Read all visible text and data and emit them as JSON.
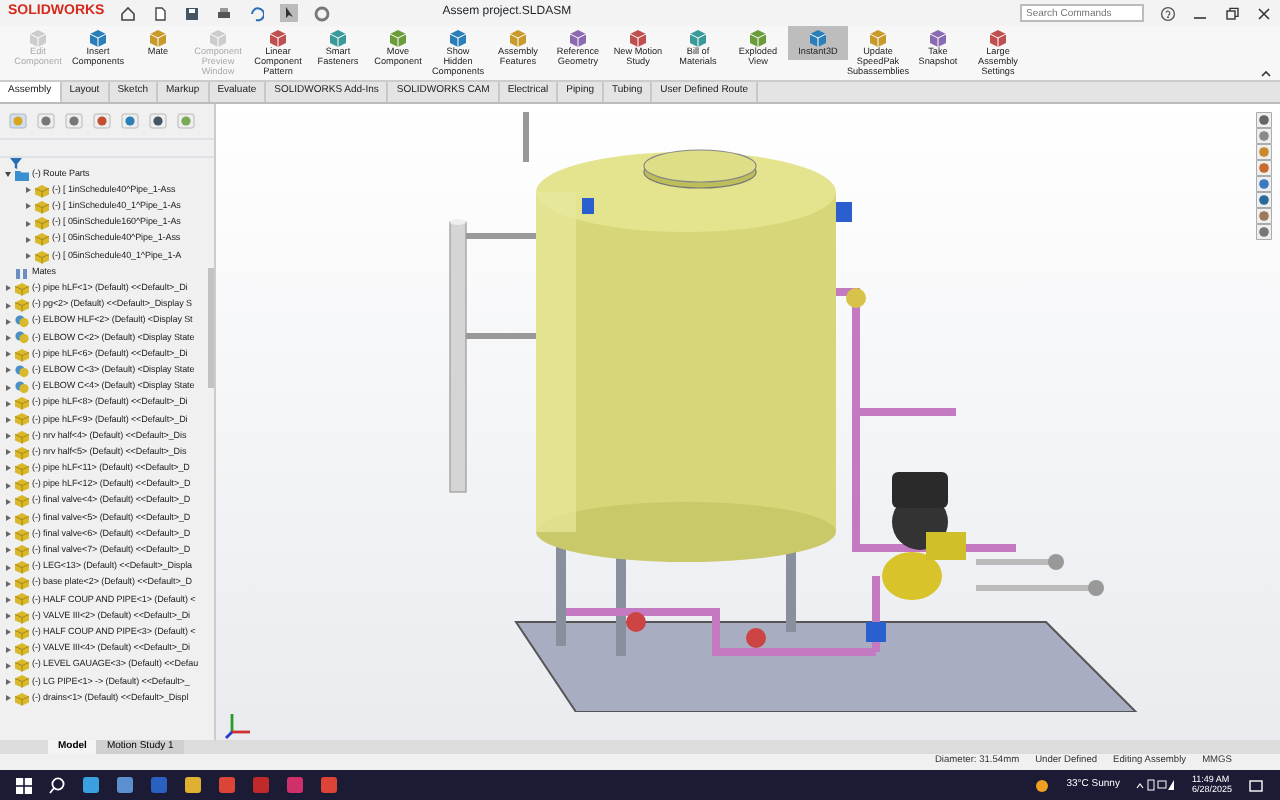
{
  "window": {
    "logo": "SOLIDWORKS",
    "title": "Assem project.SLDASM",
    "search": {
      "placeholder": "Search Commands"
    }
  },
  "ribbon": [
    {
      "label": "Edit Component",
      "disabled": true,
      "selected": false
    },
    {
      "label": "Insert Components",
      "disabled": false,
      "selected": false
    },
    {
      "label": "Mate",
      "disabled": false,
      "selected": false
    },
    {
      "label": "Component Preview Window",
      "disabled": true,
      "selected": false
    },
    {
      "label": "Linear Component Pattern",
      "disabled": false,
      "selected": false
    },
    {
      "label": "Smart Fasteners",
      "disabled": false,
      "selected": false
    },
    {
      "label": "Move Component",
      "disabled": false,
      "selected": false
    },
    {
      "label": "Show Hidden Components",
      "disabled": false,
      "selected": false
    },
    {
      "label": "Assembly Features",
      "disabled": false,
      "selected": false
    },
    {
      "label": "Reference Geometry",
      "disabled": false,
      "selected": false
    },
    {
      "label": "New Motion Study",
      "disabled": false,
      "selected": false
    },
    {
      "label": "Bill of Materials",
      "disabled": false,
      "selected": false
    },
    {
      "label": "Exploded View",
      "disabled": false,
      "selected": false
    },
    {
      "label": "Instant3D",
      "disabled": false,
      "selected": true
    },
    {
      "label": "Update SpeedPak Subassemblies",
      "disabled": false,
      "selected": false
    },
    {
      "label": "Take Snapshot",
      "disabled": false,
      "selected": false
    },
    {
      "label": "Large Assembly Settings",
      "disabled": false,
      "selected": false
    }
  ],
  "tabs": [
    {
      "label": "Assembly",
      "selected": true
    },
    {
      "label": "Layout",
      "selected": false
    },
    {
      "label": "Sketch",
      "selected": false
    },
    {
      "label": "Markup",
      "selected": false
    },
    {
      "label": "Evaluate",
      "selected": false
    },
    {
      "label": "SOLIDWORKS Add-Ins",
      "selected": false
    },
    {
      "label": "SOLIDWORKS CAM",
      "selected": false
    },
    {
      "label": "Electrical",
      "selected": false
    },
    {
      "label": "Piping",
      "selected": false
    },
    {
      "label": "Tubing",
      "selected": false
    },
    {
      "label": "User Defined Route",
      "selected": false
    }
  ],
  "feature_tree": {
    "items": [
      {
        "kind": "folder",
        "label": "(-) Route Parts",
        "expanded": true,
        "children": [
          {
            "kind": "part",
            "label": "(-) [ 1inSchedule40^Pipe_1-Ass",
            "expanded": false
          },
          {
            "kind": "part",
            "label": "(-) [ 1inSchedule40_1^Pipe_1-As",
            "expanded": false
          },
          {
            "kind": "part",
            "label": "(-) [ 05inSchedule160^Pipe_1-As",
            "expanded": false
          },
          {
            "kind": "part",
            "label": "(-) [ 05inSchedule40^Pipe_1-Ass",
            "expanded": false
          },
          {
            "kind": "part",
            "label": "(-) [ 05inSchedule40_1^Pipe_1-A",
            "expanded": false
          }
        ]
      },
      {
        "kind": "mates",
        "label": "Mates"
      },
      {
        "kind": "part",
        "label": "(-) pipe hLF<1> (Default) <<Default>_Di",
        "expanded": false
      },
      {
        "kind": "part",
        "label": "(-) pg<2> (Default) <<Default>_Display S",
        "expanded": false
      },
      {
        "kind": "assembly",
        "label": "(-) ELBOW HLF<2> (Default) <Display St",
        "expanded": false
      },
      {
        "kind": "assembly",
        "label": "(-) ELBOW C<2> (Default) <Display State",
        "expanded": false
      },
      {
        "kind": "part",
        "label": "(-) pipe hLF<6> (Default) <<Default>_Di",
        "expanded": false
      },
      {
        "kind": "assembly",
        "label": "(-) ELBOW C<3> (Default) <Display State",
        "expanded": false
      },
      {
        "kind": "assembly",
        "label": "(-) ELBOW C<4> (Default) <Display State",
        "expanded": false
      },
      {
        "kind": "part",
        "label": "(-) pipe hLF<8> (Default) <<Default>_Di",
        "expanded": false
      },
      {
        "kind": "part",
        "label": "(-) pipe hLF<9> (Default) <<Default>_Di",
        "expanded": false
      },
      {
        "kind": "part",
        "label": "(-) nrv half<4> (Default) <<Default>_Dis",
        "expanded": false
      },
      {
        "kind": "part",
        "label": "(-) nrv half<5> (Default) <<Default>_Dis",
        "expanded": false
      },
      {
        "kind": "part",
        "label": "(-) pipe hLF<11> (Default) <<Default>_D",
        "expanded": false
      },
      {
        "kind": "part",
        "label": "(-) pipe hLF<12> (Default) <<Default>_D",
        "expanded": false
      },
      {
        "kind": "part",
        "label": "(-) final valve<4> (Default) <<Default>_D",
        "expanded": false
      },
      {
        "kind": "part",
        "label": "(-) final valve<5> (Default) <<Default>_D",
        "expanded": false
      },
      {
        "kind": "part",
        "label": "(-) final valve<6> (Default) <<Default>_D",
        "expanded": false
      },
      {
        "kind": "part",
        "label": "(-) final valve<7> (Default) <<Default>_D",
        "expanded": false
      },
      {
        "kind": "part",
        "label": "(-) LEG<13> (Default) <<Default>_Displa",
        "expanded": false
      },
      {
        "kind": "part",
        "label": "(-) base plate<2> (Default) <<Default>_D",
        "expanded": false
      },
      {
        "kind": "part",
        "label": "(-) HALF COUP AND PIPE<1> (Default) <",
        "expanded": false
      },
      {
        "kind": "part",
        "label": "(-) VALVE III<2> (Default) <<Default>_Di",
        "expanded": false
      },
      {
        "kind": "part",
        "label": "(-) HALF COUP AND PIPE<3> (Default) <",
        "expanded": false
      },
      {
        "kind": "part",
        "label": "(-) VALVE III<4> (Default) <<Default>_Di",
        "expanded": false
      },
      {
        "kind": "part",
        "label": "(-) LEVEL GAUAGE<3> (Default) <<Defau",
        "expanded": false
      },
      {
        "kind": "part",
        "label": "(-) LG PIPE<1> -> (Default) <<Default>_",
        "expanded": false
      },
      {
        "kind": "part",
        "label": "(-) drains<1> (Default) <<Default>_Displ",
        "expanded": false
      }
    ]
  },
  "bottom_tabs": [
    {
      "label": "Model",
      "selected": true
    },
    {
      "label": "Motion Study 1",
      "selected": false
    }
  ],
  "status_bar": [
    "Diameter: 31.54mm",
    "Under Defined",
    "Editing Assembly",
    "MMGS"
  ],
  "taskbar": {
    "weather": "33°C  Sunny",
    "time": "11:49 AM",
    "date": "6/28/2025"
  }
}
